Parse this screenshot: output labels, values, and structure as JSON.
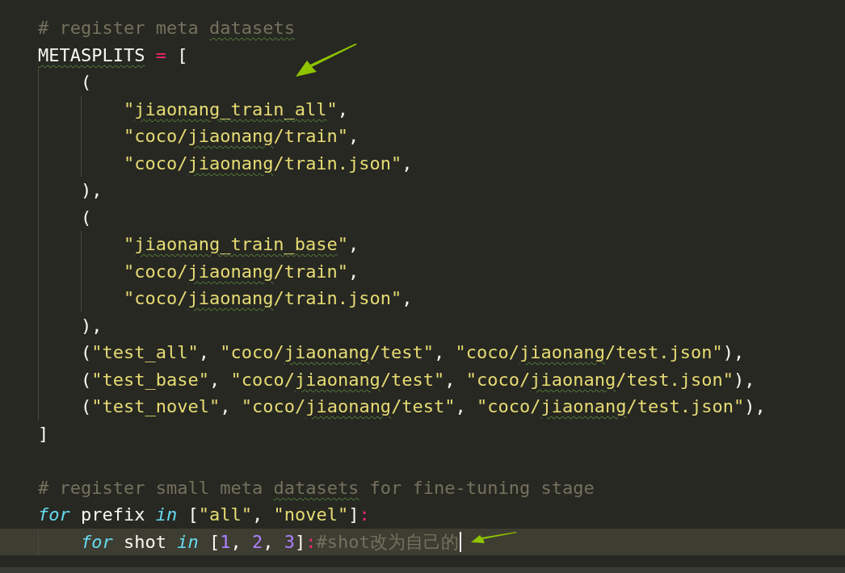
{
  "editor": {
    "blocks": [
      {
        "lines": [
          {
            "tokens": [
              {
                "kind": "comment",
                "text": "# register meta "
              },
              {
                "kind": "comment",
                "text": "datasets",
                "flagged": true
              }
            ]
          },
          {
            "tokens": [
              {
                "kind": "plain",
                "text": "METASPLITS",
                "flagged": true
              },
              {
                "kind": "operator",
                "text": " ="
              },
              {
                "kind": "plain",
                "text": " ["
              }
            ],
            "children": [
              {
                "tokens": [
                  {
                    "kind": "plain",
                    "text": "("
                  }
                ],
                "children": [
                  {
                    "tokens": [
                      {
                        "kind": "string",
                        "text": "\""
                      },
                      {
                        "kind": "string",
                        "text": "jiaonang_train_all",
                        "flagged": true
                      },
                      {
                        "kind": "string",
                        "text": "\""
                      },
                      {
                        "kind": "plain",
                        "text": ","
                      }
                    ]
                  },
                  {
                    "tokens": [
                      {
                        "kind": "string",
                        "text": "\"coco/"
                      },
                      {
                        "kind": "string",
                        "text": "jiaonang",
                        "flagged": true
                      },
                      {
                        "kind": "string",
                        "text": "/train\""
                      },
                      {
                        "kind": "plain",
                        "text": ","
                      }
                    ]
                  },
                  {
                    "tokens": [
                      {
                        "kind": "string",
                        "text": "\"coco/"
                      },
                      {
                        "kind": "string",
                        "text": "jiaonang",
                        "flagged": true
                      },
                      {
                        "kind": "string",
                        "text": "/train.json\""
                      },
                      {
                        "kind": "plain",
                        "text": ","
                      }
                    ]
                  }
                ]
              },
              {
                "tokens": [
                  {
                    "kind": "plain",
                    "text": "),"
                  }
                ]
              },
              {
                "tokens": [
                  {
                    "kind": "plain",
                    "text": "("
                  }
                ],
                "children": [
                  {
                    "tokens": [
                      {
                        "kind": "string",
                        "text": "\""
                      },
                      {
                        "kind": "string",
                        "text": "jiaonang_train_base",
                        "flagged": true
                      },
                      {
                        "kind": "string",
                        "text": "\""
                      },
                      {
                        "kind": "plain",
                        "text": ","
                      }
                    ]
                  },
                  {
                    "tokens": [
                      {
                        "kind": "string",
                        "text": "\"coco/"
                      },
                      {
                        "kind": "string",
                        "text": "jiaonang",
                        "flagged": true
                      },
                      {
                        "kind": "string",
                        "text": "/train\""
                      },
                      {
                        "kind": "plain",
                        "text": ","
                      }
                    ]
                  },
                  {
                    "tokens": [
                      {
                        "kind": "string",
                        "text": "\"coco/"
                      },
                      {
                        "kind": "string",
                        "text": "jiaonang",
                        "flagged": true
                      },
                      {
                        "kind": "string",
                        "text": "/train.json\""
                      },
                      {
                        "kind": "plain",
                        "text": ","
                      }
                    ]
                  }
                ]
              },
              {
                "tokens": [
                  {
                    "kind": "plain",
                    "text": "),"
                  }
                ]
              },
              {
                "tokens": [
                  {
                    "kind": "plain",
                    "text": "("
                  },
                  {
                    "kind": "string",
                    "text": "\"test_all\""
                  },
                  {
                    "kind": "plain",
                    "text": ", "
                  },
                  {
                    "kind": "string",
                    "text": "\"coco/"
                  },
                  {
                    "kind": "string",
                    "text": "jiaonang",
                    "flagged": true
                  },
                  {
                    "kind": "string",
                    "text": "/test\""
                  },
                  {
                    "kind": "plain",
                    "text": ", "
                  },
                  {
                    "kind": "string",
                    "text": "\"coco/"
                  },
                  {
                    "kind": "string",
                    "text": "jiaonang",
                    "flagged": true
                  },
                  {
                    "kind": "string",
                    "text": "/test.json\""
                  },
                  {
                    "kind": "plain",
                    "text": "),"
                  }
                ]
              },
              {
                "tokens": [
                  {
                    "kind": "plain",
                    "text": "("
                  },
                  {
                    "kind": "string",
                    "text": "\"test_base\""
                  },
                  {
                    "kind": "plain",
                    "text": ", "
                  },
                  {
                    "kind": "string",
                    "text": "\"coco/"
                  },
                  {
                    "kind": "string",
                    "text": "jiaonang",
                    "flagged": true
                  },
                  {
                    "kind": "string",
                    "text": "/test\""
                  },
                  {
                    "kind": "plain",
                    "text": ", "
                  },
                  {
                    "kind": "string",
                    "text": "\"coco/"
                  },
                  {
                    "kind": "string",
                    "text": "jiaonang",
                    "flagged": true
                  },
                  {
                    "kind": "string",
                    "text": "/test.json\""
                  },
                  {
                    "kind": "plain",
                    "text": "),"
                  }
                ]
              },
              {
                "tokens": [
                  {
                    "kind": "plain",
                    "text": "("
                  },
                  {
                    "kind": "string",
                    "text": "\"test_novel\""
                  },
                  {
                    "kind": "plain",
                    "text": ", "
                  },
                  {
                    "kind": "string",
                    "text": "\"coco/"
                  },
                  {
                    "kind": "string",
                    "text": "jiaonang",
                    "flagged": true
                  },
                  {
                    "kind": "string",
                    "text": "/test\""
                  },
                  {
                    "kind": "plain",
                    "text": ", "
                  },
                  {
                    "kind": "string",
                    "text": "\"coco/"
                  },
                  {
                    "kind": "string",
                    "text": "jiaonang",
                    "flagged": true
                  },
                  {
                    "kind": "string",
                    "text": "/test.json\""
                  },
                  {
                    "kind": "plain",
                    "text": "),"
                  }
                ]
              }
            ]
          },
          {
            "tokens": [
              {
                "kind": "plain",
                "text": "]"
              }
            ]
          }
        ]
      },
      {
        "lines": [
          {
            "tokens": [
              {
                "kind": "comment",
                "text": "# register small meta "
              },
              {
                "kind": "comment",
                "text": "datasets",
                "flagged": true
              },
              {
                "kind": "comment",
                "text": " for fine-tuning stage"
              }
            ]
          },
          {
            "tokens": [
              {
                "kind": "keyword",
                "text": "for"
              },
              {
                "kind": "plain",
                "text": " prefix "
              },
              {
                "kind": "keyword",
                "text": "in"
              },
              {
                "kind": "plain",
                "text": " ["
              },
              {
                "kind": "string",
                "text": "\"all\""
              },
              {
                "kind": "plain",
                "text": ", "
              },
              {
                "kind": "string",
                "text": "\"novel\""
              },
              {
                "kind": "plain",
                "text": "]"
              },
              {
                "kind": "operator",
                "text": ":"
              }
            ],
            "children": [
              {
                "current": true,
                "tokens": [
                  {
                    "kind": "keyword",
                    "text": "for"
                  },
                  {
                    "kind": "plain",
                    "text": " shot "
                  },
                  {
                    "kind": "keyword",
                    "text": "in"
                  },
                  {
                    "kind": "plain",
                    "text": " ["
                  },
                  {
                    "kind": "number",
                    "text": "1"
                  },
                  {
                    "kind": "plain",
                    "text": ", "
                  },
                  {
                    "kind": "number",
                    "text": "2"
                  },
                  {
                    "kind": "plain",
                    "text": ", "
                  },
                  {
                    "kind": "number",
                    "text": "3"
                  },
                  {
                    "kind": "plain",
                    "text": "]"
                  },
                  {
                    "kind": "operator",
                    "text": ":"
                  },
                  {
                    "kind": "comment",
                    "text": "#shot改为自己的"
                  }
                ]
              }
            ]
          }
        ]
      }
    ]
  }
}
